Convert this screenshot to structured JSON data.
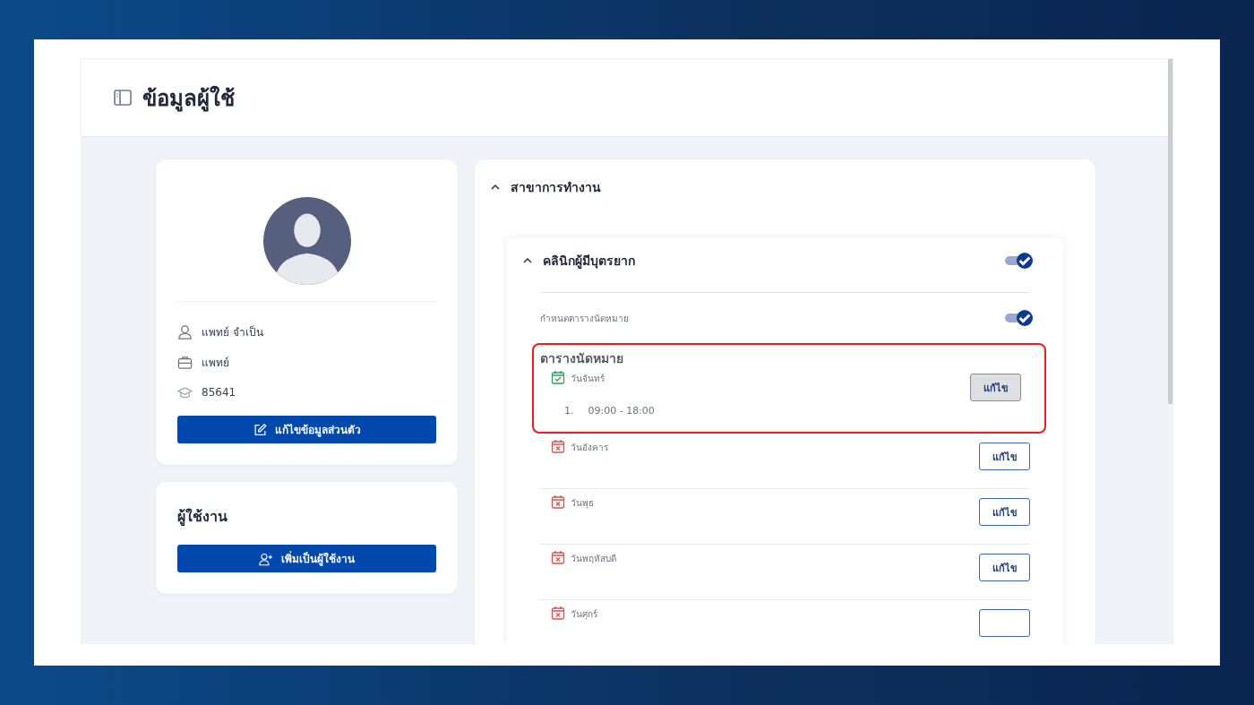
{
  "page": {
    "title": "ข้อมูลผู้ใช้"
  },
  "profile": {
    "name": "แพทย์ จำเป็น",
    "role": "แพทย์",
    "license": "85641",
    "edit_button": "แก้ไขข้อมูลส่วนตัว"
  },
  "users_card": {
    "title": "ผู้ใช้งาน",
    "button": "เพิ่มเป็นผู้ใช้งาน"
  },
  "branch_section": {
    "title": "สาขาการทำงาน",
    "expanded": true,
    "clinic": {
      "name": "คลินิกผู้มีบุตรยาก",
      "expanded": true,
      "on": true,
      "schedule_toggle": {
        "label": "กำหนดตารางนัดหมาย",
        "on": true
      },
      "schedule": {
        "title": "ตารางนัดหมาย",
        "highlighted": true,
        "days": [
          {
            "name": "วันจันทร์",
            "available": true,
            "highlighted": true,
            "pressed": true,
            "button": "แก้ไข",
            "slots": [
              {
                "number": "1.",
                "time": "09:00 - 18:00"
              }
            ]
          },
          {
            "name": "วันอังคาร",
            "available": false,
            "highlighted": false,
            "pressed": false,
            "button": "แก้ไข"
          },
          {
            "name": "วันพุธ",
            "available": false,
            "highlighted": false,
            "pressed": false,
            "button": "แก้ไข"
          },
          {
            "name": "วันพฤหัสบดี",
            "available": false,
            "highlighted": false,
            "pressed": false,
            "button": "แก้ไข"
          },
          {
            "name": "วันศุกร์",
            "available": false,
            "highlighted": false,
            "pressed": false
          }
        ]
      }
    }
  }
}
